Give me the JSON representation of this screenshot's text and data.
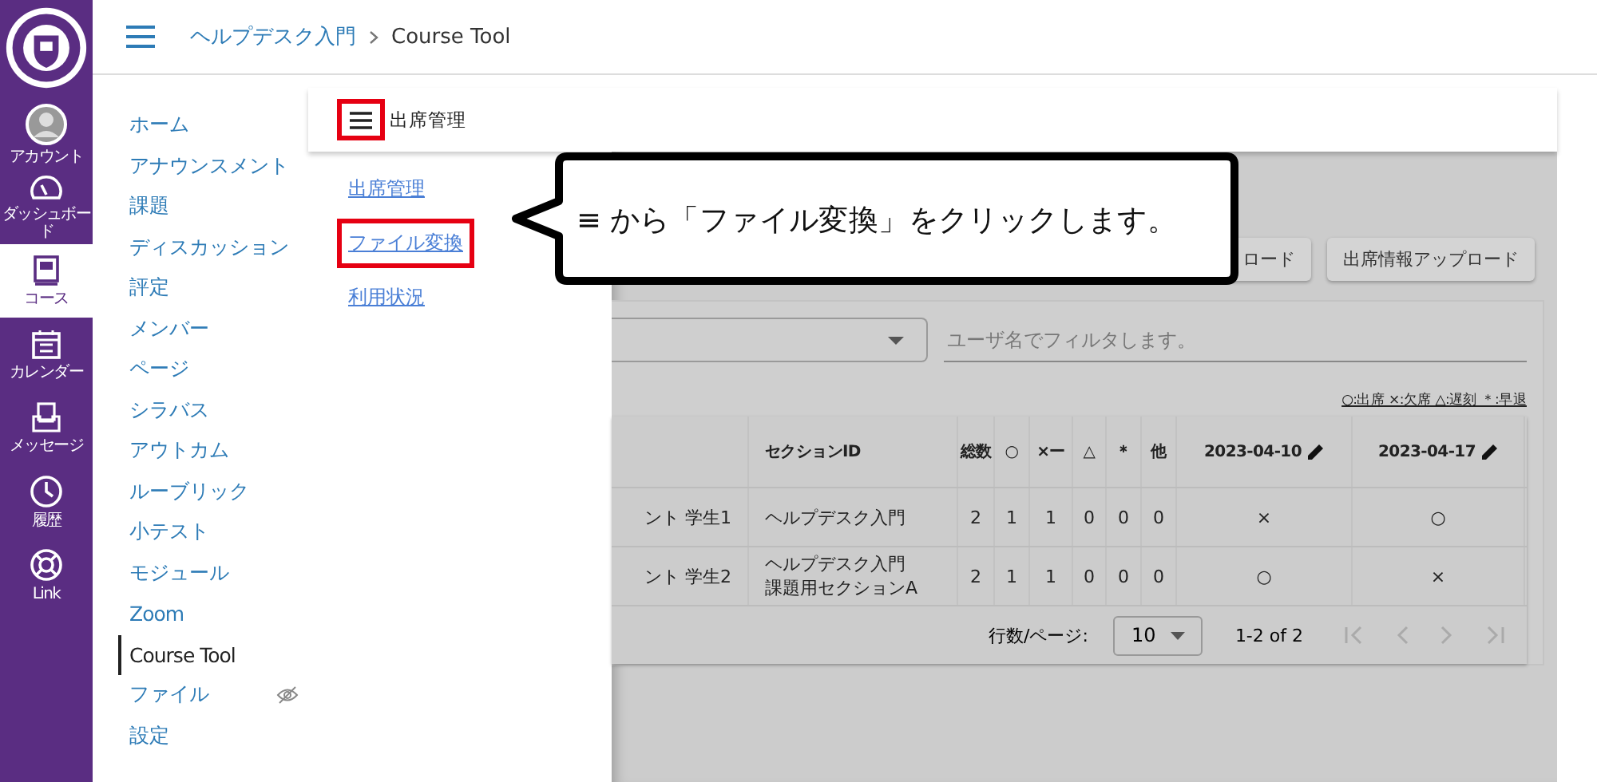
{
  "global_nav": [
    {
      "kind": "account",
      "label": "アカウント",
      "selected": false
    },
    {
      "kind": "dashboard",
      "label": "ダッシュボード",
      "selected": false
    },
    {
      "kind": "course",
      "label": "コース",
      "selected": true
    },
    {
      "kind": "calendar",
      "label": "カレンダー",
      "selected": false
    },
    {
      "kind": "inbox",
      "label": "メッセージ",
      "selected": false
    },
    {
      "kind": "history",
      "label": "履歴",
      "selected": false
    },
    {
      "kind": "help",
      "label": "Link",
      "selected": false
    }
  ],
  "breadcrumb": [
    "ヘルプデスク入門",
    "Course Tool"
  ],
  "course_nav": [
    {
      "label": "ホーム",
      "selected": false,
      "hidden": false
    },
    {
      "label": "アナウンスメント",
      "selected": false,
      "hidden": false
    },
    {
      "label": "課題",
      "selected": false,
      "hidden": false
    },
    {
      "label": "ディスカッション",
      "selected": false,
      "hidden": false
    },
    {
      "label": "評定",
      "selected": false,
      "hidden": false
    },
    {
      "label": "メンバー",
      "selected": false,
      "hidden": false
    },
    {
      "label": "ページ",
      "selected": false,
      "hidden": false
    },
    {
      "label": "シラバス",
      "selected": false,
      "hidden": false
    },
    {
      "label": "アウトカム",
      "selected": false,
      "hidden": false
    },
    {
      "label": "ルーブリック",
      "selected": false,
      "hidden": false
    },
    {
      "label": "小テスト",
      "selected": false,
      "hidden": false
    },
    {
      "label": "モジュール",
      "selected": false,
      "hidden": false
    },
    {
      "label": "Zoom",
      "selected": false,
      "hidden": false
    },
    {
      "label": "Course Tool",
      "selected": true,
      "hidden": false
    },
    {
      "label": "ファイル",
      "selected": false,
      "hidden": true
    },
    {
      "label": "設定",
      "selected": false,
      "hidden": false
    }
  ],
  "tool": {
    "title": "出席管理",
    "menu_annotated": true,
    "drawer_links": [
      {
        "label": "出席管理",
        "annotated": false
      },
      {
        "label": "ファイル変換",
        "annotated": true
      },
      {
        "label": "利用状況",
        "annotated": false
      }
    ],
    "buttons": [
      "ロード",
      "出席情報アップロード"
    ],
    "filter": {
      "placeholder": "ユーザ名でフィルタします。"
    },
    "legend": "○:出席 ×:欠席 △:遅刻 ＊:早退",
    "columns": [
      {},
      {
        "label": "セクションID",
        "editable": false
      },
      {
        "label": "総数",
        "editable": false
      },
      {
        "label": "○",
        "editable": false
      },
      {
        "label": "×ー",
        "editable": false
      },
      {
        "label": "△",
        "editable": false
      },
      {
        "label": "＊",
        "editable": false
      },
      {
        "label": "他",
        "editable": false
      },
      {
        "label": "2023-04-10",
        "editable": true
      },
      {
        "label": "2023-04-17",
        "editable": true
      }
    ],
    "rows": [
      [
        "ント 学生1",
        "ヘルプデスク入門",
        "2",
        "1",
        "1",
        "0",
        "0",
        "0",
        "×",
        "○"
      ],
      [
        "ント 学生2",
        "ヘルプデスク入門課題用セクションA",
        "2",
        "1",
        "1",
        "0",
        "0",
        "0",
        "○",
        "×"
      ]
    ],
    "pagination": {
      "rows_label": "行数/ページ:",
      "rows_per_page": "10",
      "range": "1-2 of 2"
    }
  },
  "callout": {
    "text": "≡ から「ファイル変換」をクリックします。"
  }
}
